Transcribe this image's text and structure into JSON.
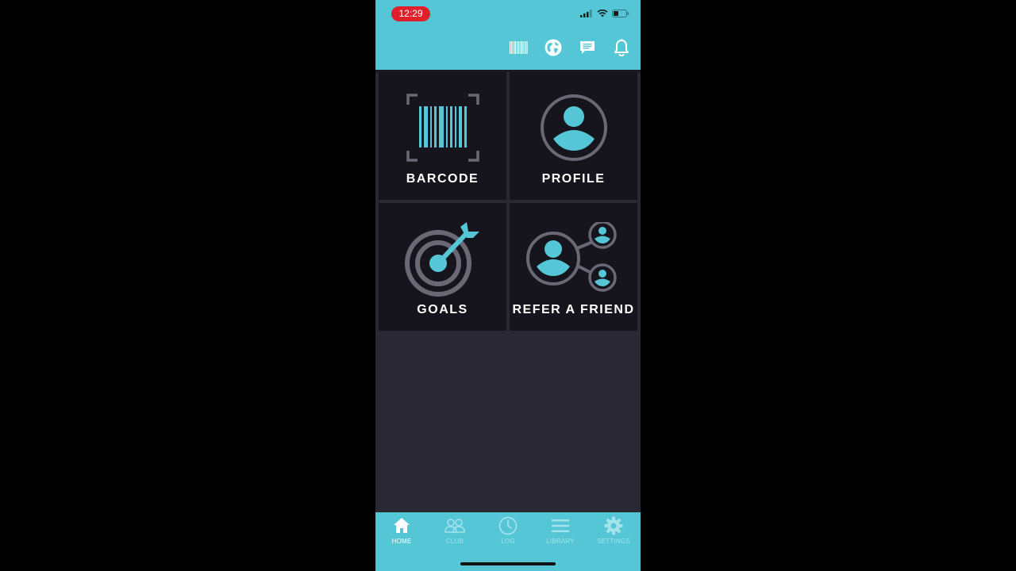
{
  "status_bar": {
    "time": "12:29"
  },
  "header_actions": [
    {
      "icon": "barcode-icon"
    },
    {
      "icon": "globe-icon"
    },
    {
      "icon": "chat-icon"
    },
    {
      "icon": "bell-icon"
    }
  ],
  "tiles": [
    {
      "label": "BARCODE",
      "icon": "barcode-scan-icon"
    },
    {
      "label": "PROFILE",
      "icon": "profile-icon"
    },
    {
      "label": "GOALS",
      "icon": "target-icon"
    },
    {
      "label": "REFER A FRIEND",
      "icon": "refer-friend-icon"
    }
  ],
  "tab_bar": {
    "tabs": [
      {
        "label": "HOME",
        "icon": "home-icon",
        "active": true
      },
      {
        "label": "CLUB",
        "icon": "club-icon",
        "active": false
      },
      {
        "label": "LOG",
        "icon": "clock-icon",
        "active": false
      },
      {
        "label": "LIBRARY",
        "icon": "menu-icon",
        "active": false
      },
      {
        "label": "SETTINGS",
        "icon": "gear-icon",
        "active": false
      }
    ]
  },
  "colors": {
    "accent": "#55c6d6",
    "tile_background": "#16141c",
    "page_background": "#2a2832",
    "icon_ring": "#6b6875",
    "time_pill": "#e01f2b"
  }
}
